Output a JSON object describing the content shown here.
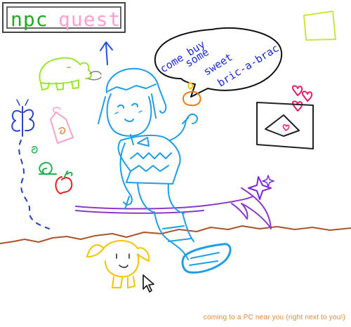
{
  "title": {
    "word1": "npc",
    "word2": "quest"
  },
  "speech_bubble": {
    "lines": [
      "come buy",
      "some",
      "sweet",
      "bric-a-brac"
    ]
  },
  "tagline": "coming to a PC near you (right next to you!)",
  "colors": {
    "title_npc": "#22aa22",
    "title_quest": "#ff9fd0",
    "character": "#1e9ee6",
    "speech_text": "#1a2bd8",
    "broom": "#8a3ac8",
    "ground": "#a9542a",
    "tagline": "#e08a3a",
    "yellow_creature": "#f5c400",
    "green_creature": "#9be62a"
  },
  "icons": [
    "up-arrow-icon",
    "mouse-cursor-icon",
    "envelope-icon",
    "heart-icon",
    "sparkle-icon",
    "butterfly-icon",
    "snail-icon",
    "apple-icon",
    "sticky-note-icon"
  ]
}
